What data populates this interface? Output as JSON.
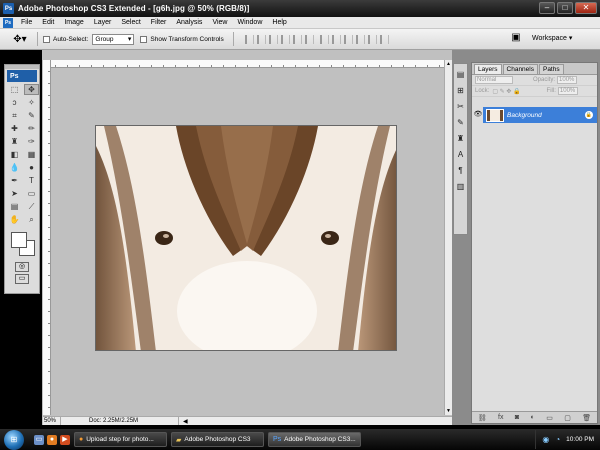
{
  "window": {
    "title": "Adobe Photoshop CS3 Extended - [g6h.jpg @ 50% (RGB/8)]"
  },
  "menu": [
    "File",
    "Edit",
    "Image",
    "Layer",
    "Select",
    "Filter",
    "Analysis",
    "View",
    "Window",
    "Help"
  ],
  "options": {
    "auto_select_label": "Auto-Select:",
    "auto_select_value": "Group",
    "show_transform_label": "Show Transform Controls",
    "workspace_label": "Workspace ▾"
  },
  "tools": {
    "logo": "Ps"
  },
  "status": {
    "zoom": "50%",
    "doc_info": "Doc: 2.25M/2.25M"
  },
  "layers_panel": {
    "tabs": [
      "Layers",
      "Channels",
      "Paths"
    ],
    "blend_mode": "Normal",
    "opacity_label": "Opacity:",
    "opacity_value": "100%",
    "lock_label": "Lock:",
    "fill_label": "Fill:",
    "fill_value": "100%",
    "layer_name": "Background"
  },
  "taskbar": {
    "tasks": [
      "Upload step for photo...",
      "Adobe Photoshop CS3",
      "Adobe Photoshop CS3..."
    ],
    "clock": "10:00 PM"
  },
  "colors": {
    "layer_selected": "#3c7fd9",
    "workspace_bg": "#c0c0c0",
    "image_tone": "#6b4a2e"
  }
}
